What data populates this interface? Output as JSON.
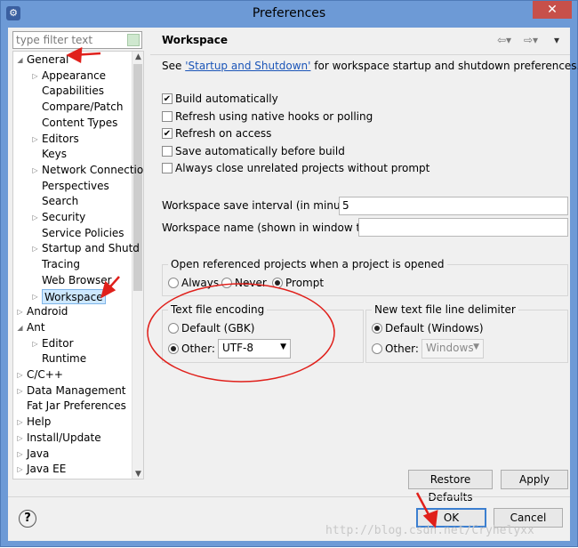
{
  "window": {
    "title": "Preferences",
    "close_glyph": "✕",
    "app_icon": "eclipse-preferences-icon"
  },
  "filter": {
    "placeholder": "type filter text"
  },
  "tree": {
    "items": [
      {
        "label": "General",
        "twisty": "◢"
      },
      {
        "label": "Appearance",
        "twisty": "▷"
      },
      {
        "label": "Capabilities",
        "twisty": ""
      },
      {
        "label": "Compare/Patch",
        "twisty": ""
      },
      {
        "label": "Content Types",
        "twisty": ""
      },
      {
        "label": "Editors",
        "twisty": "▷"
      },
      {
        "label": "Keys",
        "twisty": ""
      },
      {
        "label": "Network Connectio",
        "twisty": "▷"
      },
      {
        "label": "Perspectives",
        "twisty": ""
      },
      {
        "label": "Search",
        "twisty": ""
      },
      {
        "label": "Security",
        "twisty": "▷"
      },
      {
        "label": "Service Policies",
        "twisty": ""
      },
      {
        "label": "Startup and Shutd",
        "twisty": "▷"
      },
      {
        "label": "Tracing",
        "twisty": ""
      },
      {
        "label": "Web Browser",
        "twisty": ""
      },
      {
        "label": "Workspace",
        "twisty": "▷"
      },
      {
        "label": "Android",
        "twisty": "▷"
      },
      {
        "label": "Ant",
        "twisty": "◢"
      },
      {
        "label": "Editor",
        "twisty": "▷"
      },
      {
        "label": "Runtime",
        "twisty": ""
      },
      {
        "label": "C/C++",
        "twisty": "▷"
      },
      {
        "label": "Data Management",
        "twisty": "▷"
      },
      {
        "label": "Fat Jar Preferences",
        "twisty": ""
      },
      {
        "label": "Help",
        "twisty": "▷"
      },
      {
        "label": "Install/Update",
        "twisty": "▷"
      },
      {
        "label": "Java",
        "twisty": "▷"
      },
      {
        "label": "Java EE",
        "twisty": "▷"
      }
    ],
    "selected": "Workspace"
  },
  "page": {
    "title": "Workspace",
    "see_prefix": "See ",
    "see_link": "'Startup and Shutdown'",
    "see_suffix": " for workspace startup and shutdown preferences.",
    "checkboxes": [
      {
        "label": "Build automatically",
        "checked": true
      },
      {
        "label": "Refresh using native hooks or polling",
        "checked": false
      },
      {
        "label": "Refresh on access",
        "checked": true
      },
      {
        "label": "Save automatically before build",
        "checked": false
      },
      {
        "label": "Always close unrelated projects without prompt",
        "checked": false
      }
    ],
    "save_interval_label": "Workspace save interval (in minutes):",
    "save_interval_value": "5",
    "name_label": "Workspace name (shown in window title):",
    "name_value": "",
    "open_group": {
      "title": "Open referenced projects when a project is opened",
      "options": [
        "Always",
        "Never",
        "Prompt"
      ],
      "selected": "Prompt"
    },
    "encoding_group": {
      "title": "Text file encoding",
      "default_label": "Default (GBK)",
      "other_label": "Other:",
      "other_value": "UTF-8",
      "selected": "Other"
    },
    "delimiter_group": {
      "title": "New text file line delimiter",
      "default_label": "Default (Windows)",
      "other_label": "Other:",
      "other_value": "Windows",
      "selected": "Default"
    },
    "restore_defaults": "Restore Defaults",
    "apply": "Apply"
  },
  "footer": {
    "help": "?",
    "ok": "OK",
    "cancel": "Cancel"
  },
  "watermark": "http://blog.csdn.net/Cryhelyxx",
  "colors": {
    "annotation_red": "#e0201b",
    "titlebar": "#6d9ad6",
    "link": "#1b55b8"
  }
}
